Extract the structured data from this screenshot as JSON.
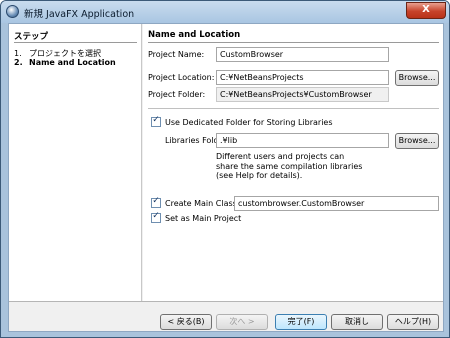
{
  "window": {
    "title": "新規 JavaFX Application",
    "close_glyph": "X",
    "app_icon": "netbeans-app-icon"
  },
  "steps": {
    "title": "ステップ",
    "items": [
      {
        "num": "1.",
        "label": "プロジェクトを選択"
      },
      {
        "num": "2.",
        "label": "Name and Location"
      }
    ]
  },
  "panel": {
    "title": "Name and Location",
    "project_name": {
      "label": "Project Name:",
      "value": "CustomBrowser"
    },
    "project_location": {
      "label": "Project Location:",
      "value": "C:¥NetBeansProjects",
      "button": "Browse..."
    },
    "project_folder": {
      "label": "Project Folder:",
      "value": "C:¥NetBeansProjects¥CustomBrowser"
    },
    "dedicated_folder": {
      "label": "Use Dedicated Folder for Storing Libraries",
      "checked": true
    },
    "libraries_folder": {
      "label": "Libraries Folder:",
      "value": ".¥lib",
      "button": "Browse..."
    },
    "libraries_note": "Different users and projects can share the same compilation libraries (see Help for details).",
    "create_main_class": {
      "label": "Create Main Class",
      "checked": true,
      "value": "custombrowser.CustomBrowser"
    },
    "set_main_project": {
      "label": "Set as Main Project",
      "checked": true
    }
  },
  "footer": {
    "back": "< 戻る(B)",
    "next": "次へ >",
    "finish": "完了(F)",
    "cancel": "取消し",
    "help": "ヘルプ(H)"
  }
}
